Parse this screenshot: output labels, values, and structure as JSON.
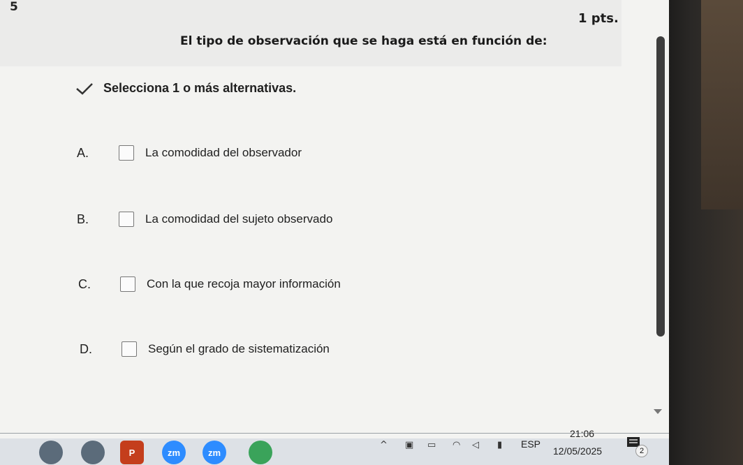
{
  "question": {
    "number": "5",
    "points": "1 pts.",
    "title": "El tipo de observación que se haga está en función de:",
    "instruction": "Selecciona 1 o más alternativas."
  },
  "options": [
    {
      "letter": "A.",
      "text": "La comodidad del observador"
    },
    {
      "letter": "B.",
      "text": "La comodidad del sujeto observado"
    },
    {
      "letter": "C.",
      "text": "Con la que recoja mayor información"
    },
    {
      "letter": "D.",
      "text": "Según el grado de sistematización"
    }
  ],
  "taskbar": {
    "apps": [
      {
        "icon": "chrome-icon",
        "label": "",
        "color": "#5b6b7a"
      },
      {
        "icon": "chrome-icon",
        "label": "",
        "color": "#5b6b7a"
      },
      {
        "icon": "powerpoint-icon",
        "label": "P",
        "color": "#c43e1c"
      },
      {
        "icon": "zoom-icon",
        "label": "zm",
        "color": "#2d8cff"
      },
      {
        "icon": "zoom-icon",
        "label": "zm",
        "color": "#2d8cff"
      },
      {
        "icon": "app-icon",
        "label": "",
        "color": "#3aa35a"
      }
    ],
    "language": "ESP",
    "time": "21:06",
    "date": "12/05/2025",
    "notifications": "2"
  }
}
